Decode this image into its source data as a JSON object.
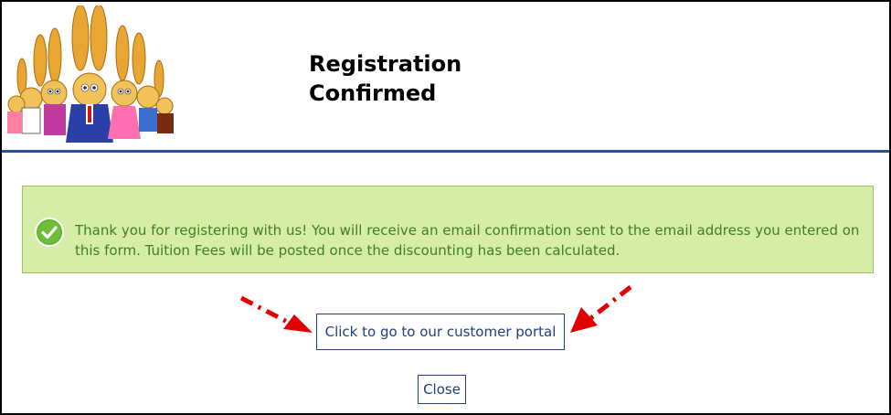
{
  "header": {
    "title_line1": "Registration",
    "title_line2": "Confirmed",
    "logo_icon": "bunny-mascots-logo"
  },
  "alert": {
    "icon": "checkmark-circle-icon",
    "message": "Thank you for registering with us! You will receive an email confirmation sent to the email address you entered on this form. Tuition Fees will be posted once the discounting has been calculated.",
    "background": "#d6eda8",
    "text_color": "#3e7f1e"
  },
  "actions": {
    "portal_label": "Click to go to our customer portal",
    "close_label": "Close"
  },
  "annotations": {
    "arrow_color": "#e00000"
  },
  "colors": {
    "header_rule": "#2f4f8f",
    "button_border": "#1f3f7f"
  }
}
